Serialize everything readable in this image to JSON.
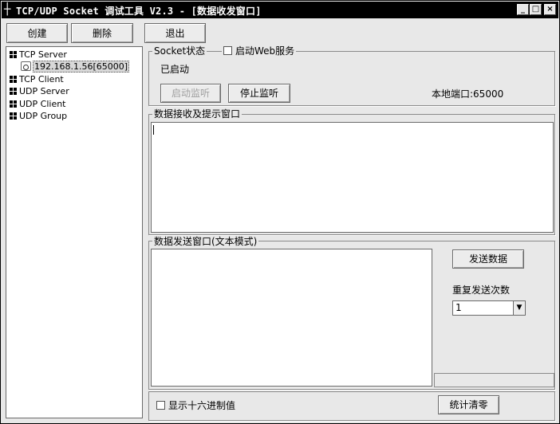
{
  "window": {
    "title": "TCP/UDP Socket 调试工具 V2.3 - [数据收发窗口]",
    "app_icon": "cross-icon",
    "controls": {
      "minimize": "_",
      "maximize": "□",
      "close": "×"
    }
  },
  "toolbar": {
    "create_label": "创建",
    "delete_label": "删除",
    "exit_label": "退出"
  },
  "tree": {
    "tcp_server": "TCP Server",
    "tcp_server_conn": "192.168.1.56[65000]",
    "tcp_client": "TCP Client",
    "udp_server": "UDP Server",
    "udp_client": "UDP Client",
    "udp_group": "UDP Group"
  },
  "socket_panel": {
    "group_label": "Socket状态",
    "web_service_label": "启动Web服务",
    "web_service_checked": false,
    "status_text": "已启动",
    "start_listen_label": "启动监听",
    "stop_listen_label": "停止监听",
    "local_port_text": "本地端口:65000"
  },
  "receive_panel": {
    "group_label": "数据接收及提示窗口",
    "content": ""
  },
  "send_panel": {
    "group_label": "数据发送窗口(文本模式)",
    "content": "",
    "send_button_label": "发送数据",
    "repeat_label": "重复发送次数",
    "repeat_value": "1"
  },
  "bottom": {
    "hex_display_label": "显示十六进制值",
    "hex_display_checked": false,
    "clear_stats_label": "统计清零"
  }
}
